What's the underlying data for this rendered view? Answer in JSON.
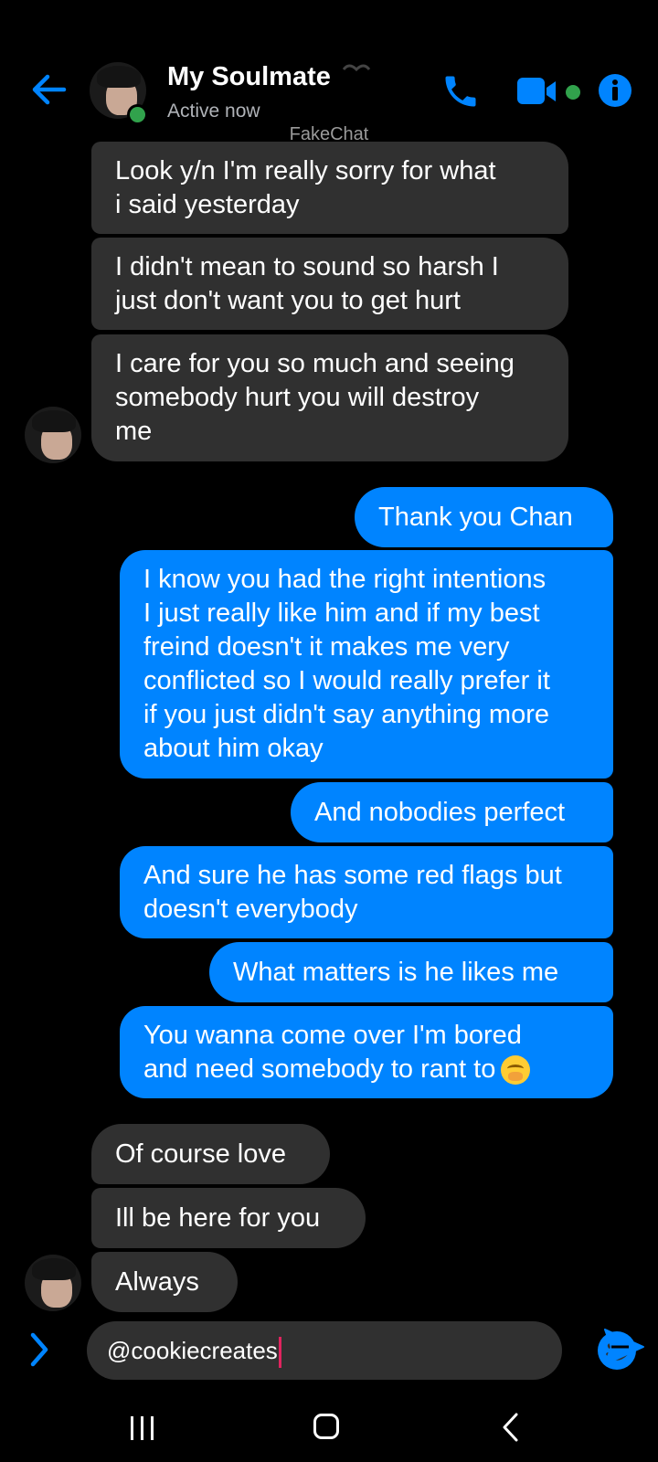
{
  "header": {
    "contact_name": "My Soulmate",
    "status": "Active now",
    "watermark": "FakeChat"
  },
  "messages": [
    {
      "dir": "in",
      "text": "Look y/n I'm really sorry for what\ni said yesterday"
    },
    {
      "dir": "in",
      "text": "I didn't mean to sound so harsh I\njust don't want you to get hurt"
    },
    {
      "dir": "in",
      "text": "I care for you so much and seeing\nsomebody hurt you will destroy\nme"
    },
    {
      "dir": "out",
      "text": "Thank you Chan"
    },
    {
      "dir": "out",
      "text": "I know you had the right intentions\nI just really like him and if my best\nfreind doesn't it makes me very\nconflicted so I would really prefer it\nif you just didn't say anything more\nabout him okay"
    },
    {
      "dir": "out",
      "text": "And nobodies perfect"
    },
    {
      "dir": "out",
      "text": "And sure he has some red flags but\ndoesn't everybody"
    },
    {
      "dir": "out",
      "text": "What matters is he likes me"
    },
    {
      "dir": "out",
      "text": "You wanna come over I'm bored\nand need somebody to rant to",
      "emoji": "face-with-hand-over-mouth"
    },
    {
      "dir": "in",
      "text": "Of course love"
    },
    {
      "dir": "in",
      "text": "Ill be here for you"
    },
    {
      "dir": "in",
      "text": "Always"
    }
  ],
  "composer": {
    "value": "@cookiecreates"
  },
  "icons": {
    "back": "back-arrow-icon",
    "call": "phone-icon",
    "video": "video-camera-icon",
    "info": "info-icon",
    "expand": "chevron-right-icon",
    "emoji": "smiley-icon",
    "send": "send-icon"
  },
  "colors": {
    "accent": "#0084ff",
    "incoming_bubble": "#303030",
    "outgoing_bubble": "#0084ff",
    "online": "#31a24c",
    "background": "#000000"
  }
}
